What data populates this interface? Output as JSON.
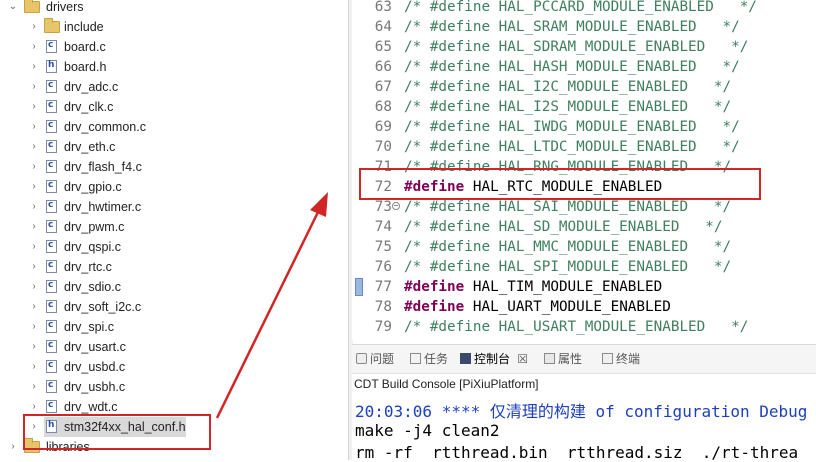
{
  "tree": {
    "items": [
      {
        "label": "drivers",
        "icon": "folder-icon",
        "expanded": true
      },
      {
        "label": "include",
        "icon": "folder-icon"
      },
      {
        "label": "board.c",
        "icon": "c-file-icon"
      },
      {
        "label": "board.h",
        "icon": "h-file-icon"
      },
      {
        "label": "drv_adc.c",
        "icon": "c-file-icon"
      },
      {
        "label": "drv_clk.c",
        "icon": "c-file-icon"
      },
      {
        "label": "drv_common.c",
        "icon": "c-file-icon"
      },
      {
        "label": "drv_eth.c",
        "icon": "c-file-icon"
      },
      {
        "label": "drv_flash_f4.c",
        "icon": "c-file-icon"
      },
      {
        "label": "drv_gpio.c",
        "icon": "c-file-icon"
      },
      {
        "label": "drv_hwtimer.c",
        "icon": "c-file-icon"
      },
      {
        "label": "drv_pwm.c",
        "icon": "c-file-icon"
      },
      {
        "label": "drv_qspi.c",
        "icon": "c-file-icon"
      },
      {
        "label": "drv_rtc.c",
        "icon": "c-file-icon"
      },
      {
        "label": "drv_sdio.c",
        "icon": "c-file-icon"
      },
      {
        "label": "drv_soft_i2c.c",
        "icon": "c-file-icon"
      },
      {
        "label": "drv_spi.c",
        "icon": "c-file-icon"
      },
      {
        "label": "drv_usart.c",
        "icon": "c-file-icon"
      },
      {
        "label": "drv_usbd.c",
        "icon": "c-file-icon"
      },
      {
        "label": "drv_usbh.c",
        "icon": "c-file-icon"
      },
      {
        "label": "drv_wdt.c",
        "icon": "c-file-icon"
      },
      {
        "label": "stm32f4xx_hal_conf.h",
        "icon": "h-file-icon",
        "selected": true
      },
      {
        "label": "libraries",
        "icon": "folder-icon"
      }
    ]
  },
  "editor": {
    "lines": [
      {
        "num": "63",
        "text": "/* #define HAL_PCCARD_MODULE_ENABLED   */"
      },
      {
        "num": "64",
        "text": "/* #define HAL_SRAM_MODULE_ENABLED   */"
      },
      {
        "num": "65",
        "text": "/* #define HAL_SDRAM_MODULE_ENABLED   */"
      },
      {
        "num": "66",
        "text": "/* #define HAL_HASH_MODULE_ENABLED   */"
      },
      {
        "num": "67",
        "text": "/* #define HAL_I2C_MODULE_ENABLED   */"
      },
      {
        "num": "68",
        "text": "/* #define HAL_I2S_MODULE_ENABLED   */"
      },
      {
        "num": "69",
        "text": "/* #define HAL_IWDG_MODULE_ENABLED   */"
      },
      {
        "num": "70",
        "text": "/* #define HAL_LTDC_MODULE_ENABLED   */"
      },
      {
        "num": "71",
        "text": "/* #define HAL_RNG_MODULE_ENABLED   */"
      },
      {
        "num": "72",
        "kw": "#define",
        "text": " HAL_RTC_MODULE_ENABLED"
      },
      {
        "num": "73",
        "text": "/* #define HAL_SAI_MODULE_ENABLED   */"
      },
      {
        "num": "74",
        "text": "/* #define HAL_SD_MODULE_ENABLED   */"
      },
      {
        "num": "75",
        "text": "/* #define HAL_MMC_MODULE_ENABLED   */"
      },
      {
        "num": "76",
        "text": "/* #define HAL_SPI_MODULE_ENABLED   */"
      },
      {
        "num": "77",
        "kw": "#define",
        "text": " HAL_TIM_MODULE_ENABLED"
      },
      {
        "num": "78",
        "kw": "#define",
        "text": " HAL_UART_MODULE_ENABLED"
      },
      {
        "num": "79",
        "text": "/* #define HAL_USART_MODULE_ENABLED   */"
      }
    ]
  },
  "console": {
    "tabs": [
      {
        "label": "问题",
        "icon": "problems-icon"
      },
      {
        "label": "任务",
        "icon": "tasks-icon"
      },
      {
        "label": "控制台",
        "icon": "console-icon",
        "active": true,
        "close": "☒"
      },
      {
        "label": "属性",
        "icon": "properties-icon"
      },
      {
        "label": "终端",
        "icon": "terminal-icon"
      }
    ],
    "title": "CDT Build Console [PiXiuPlatform]",
    "output": [
      "20:03:06 **** 仅清理的构建 of configuration Debug",
      "make -j4 clean2",
      "rm -rf  rtthread.bin  rtthread.siz  ./rt-threa"
    ]
  },
  "colors": {
    "annotation": "#d22626",
    "keyword": "#7f0055",
    "comment": "#3f7f5f",
    "console_blue": "#1c3fbf"
  }
}
